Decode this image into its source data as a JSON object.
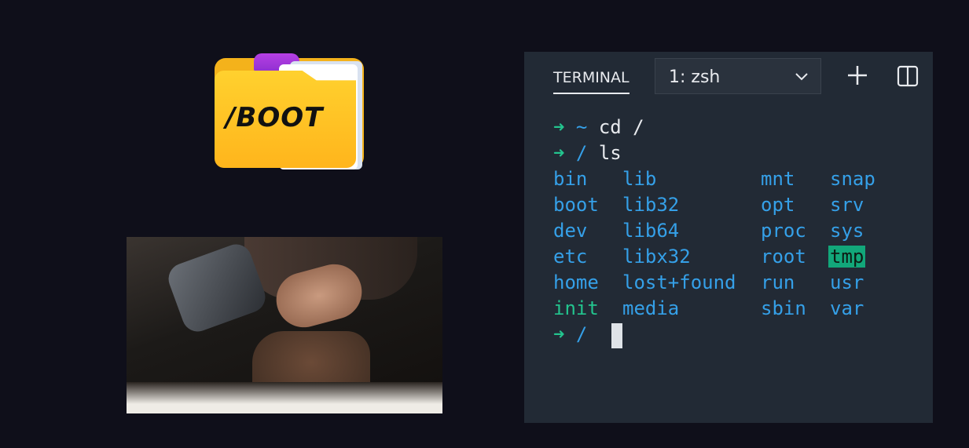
{
  "folder": {
    "label": "/BOOT",
    "tab_color": "#b640e4",
    "body_color": "#ffc21f"
  },
  "photo": {
    "alt": "robotic hand"
  },
  "terminal": {
    "tab_label": "TERMINAL",
    "shell_select": {
      "value": "1: zsh"
    },
    "add_label": "+",
    "lines": [
      {
        "prompt": "➜",
        "dir": "~",
        "cmd": "cd /"
      },
      {
        "prompt": "➜",
        "dir": "/",
        "cmd": "ls"
      }
    ],
    "listing": {
      "col1": [
        "bin",
        "boot",
        "dev",
        "etc",
        "home",
        "init"
      ],
      "col2": [
        "lib",
        "lib32",
        "lib64",
        "libx32",
        "lost+found",
        "media"
      ],
      "col3": [
        "mnt",
        "opt",
        "proc",
        "root",
        "run",
        "sbin"
      ],
      "col4": [
        "snap",
        "srv",
        "sys",
        "tmp",
        "usr",
        "var"
      ]
    },
    "final_prompt": {
      "prompt": "➜",
      "dir": "/"
    },
    "colors": {
      "arrow": "#23c48e",
      "dir": "#35a0e8",
      "highlight": "#12a77a",
      "background": "#222a35"
    }
  }
}
